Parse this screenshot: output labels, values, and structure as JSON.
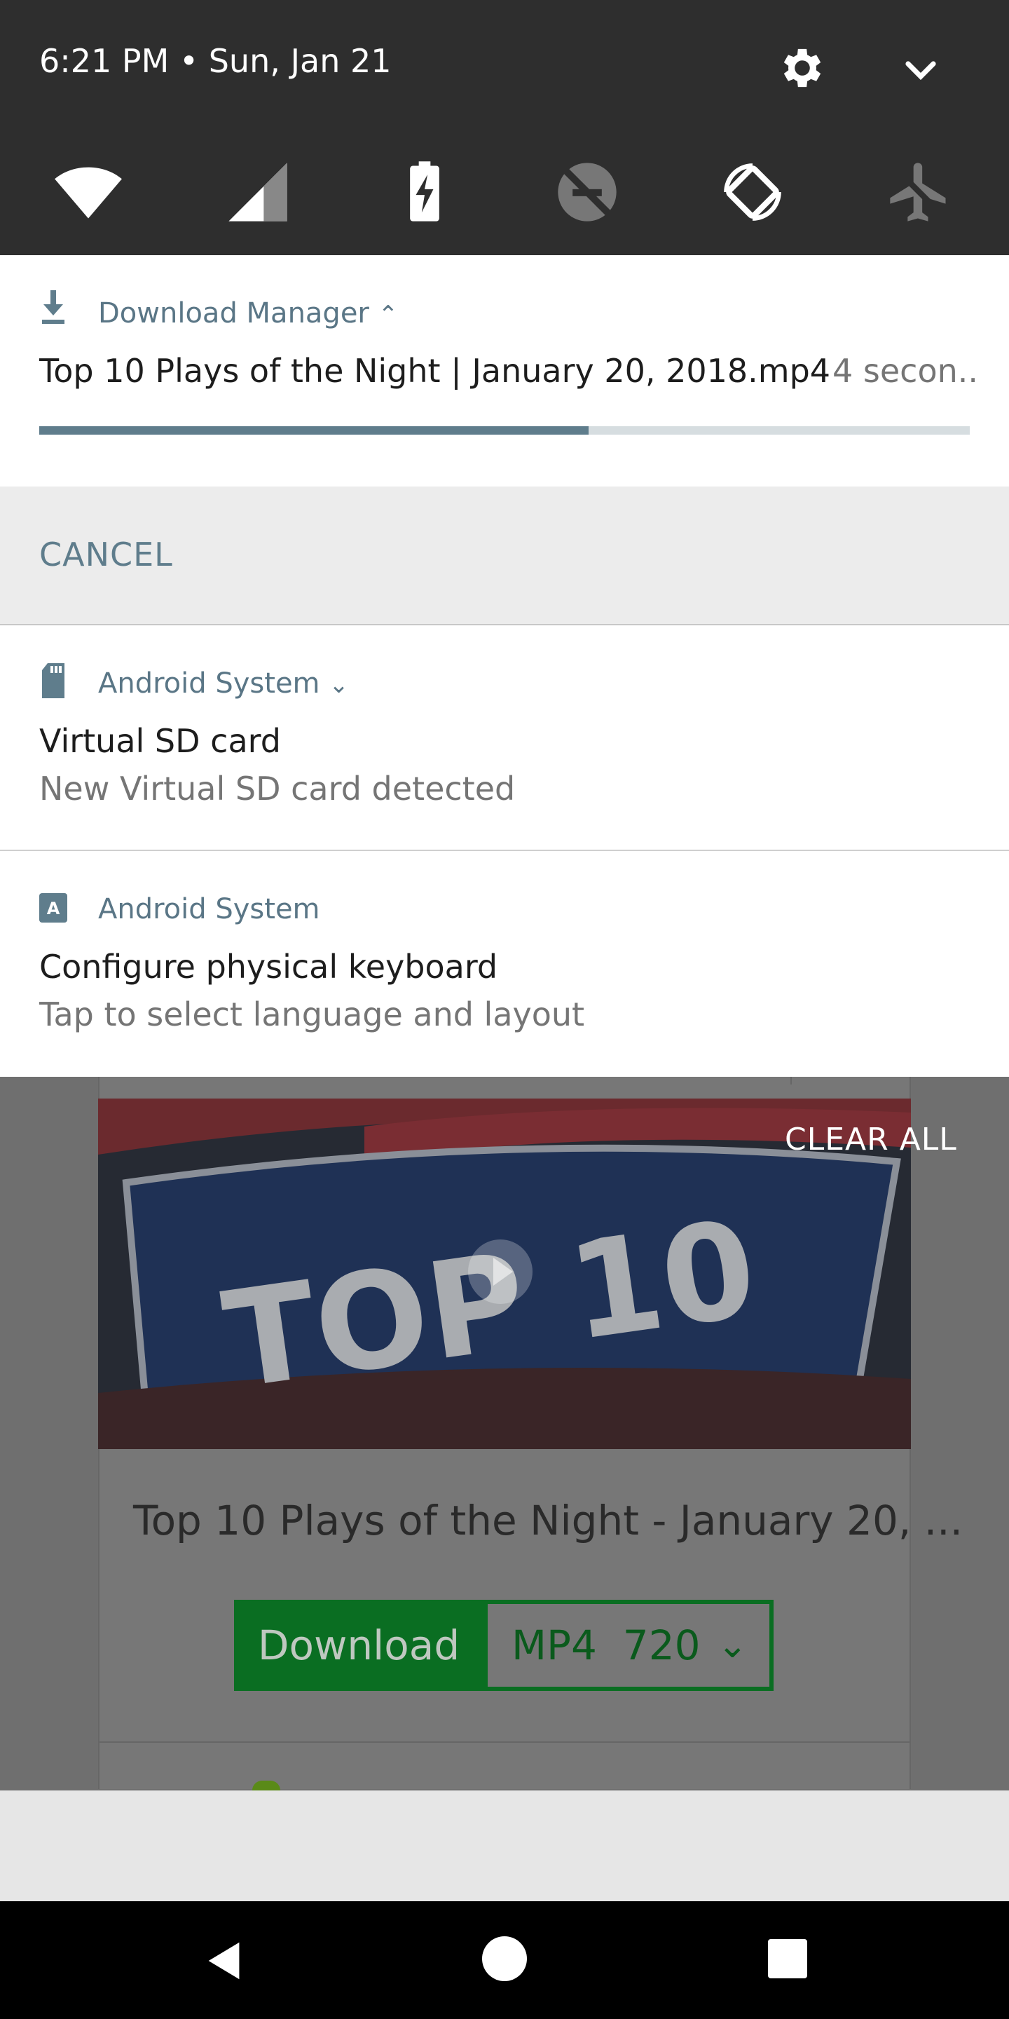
{
  "status_bar": {
    "time_date": "6:21 PM • Sun, Jan 21"
  },
  "quick_settings": {
    "tiles": [
      "wifi-icon",
      "cellular-signal-icon",
      "battery-charging-icon",
      "do-not-disturb-icon",
      "auto-rotate-icon",
      "airplane-mode-icon"
    ]
  },
  "notifications": [
    {
      "app": "Download Manager",
      "title": "Top 10 Plays of the Night | January 20, 2018.mp4",
      "time_left": "4 secon..",
      "progress": 0.59,
      "action": "CANCEL"
    },
    {
      "app": "Android System",
      "title": "Virtual SD card",
      "text": "New Virtual SD card detected"
    },
    {
      "app": "Android System",
      "title": "Configure physical keyboard",
      "text": "Tap to select language and layout"
    }
  ],
  "clear_all": "CLEAR ALL",
  "background_page": {
    "video_title": "Top 10 Plays of the Night - January 20, ...",
    "thumbnail_text": "TOP 10",
    "download_label": "Download",
    "format_value": "MP4  720"
  },
  "colors": {
    "accent": "#5f7d8c",
    "download_green": "#0a6e22",
    "shade": "#2e2e2e"
  }
}
